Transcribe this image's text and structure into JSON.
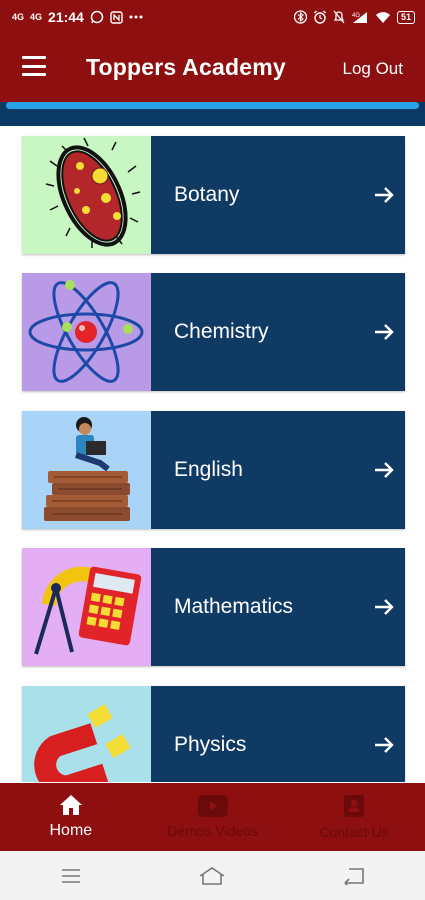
{
  "status_bar": {
    "signal_1": "4G",
    "signal_2": "4G",
    "time": "21:44",
    "battery": "51"
  },
  "app_bar": {
    "title": "Toppers Academy",
    "logout_label": "Log Out"
  },
  "subjects": [
    {
      "label": "Botany",
      "bg": "#c9f7c3"
    },
    {
      "label": "Chemistry",
      "bg": "#b99ae6"
    },
    {
      "label": "English",
      "bg": "#a9d4f7"
    },
    {
      "label": "Mathematics",
      "bg": "#e4aef5"
    },
    {
      "label": "Physics",
      "bg": "#a9e0ea"
    }
  ],
  "bottom_nav": [
    {
      "label": "Home",
      "icon": "home-icon",
      "active": true
    },
    {
      "label": "Demos Videos",
      "icon": "youtube-icon",
      "active": false
    },
    {
      "label": "Contact Us",
      "icon": "contact-icon",
      "active": false
    }
  ],
  "colors": {
    "primary": "#8e0f0f",
    "card": "#0f3a64",
    "accent": "#2aa3e6"
  }
}
